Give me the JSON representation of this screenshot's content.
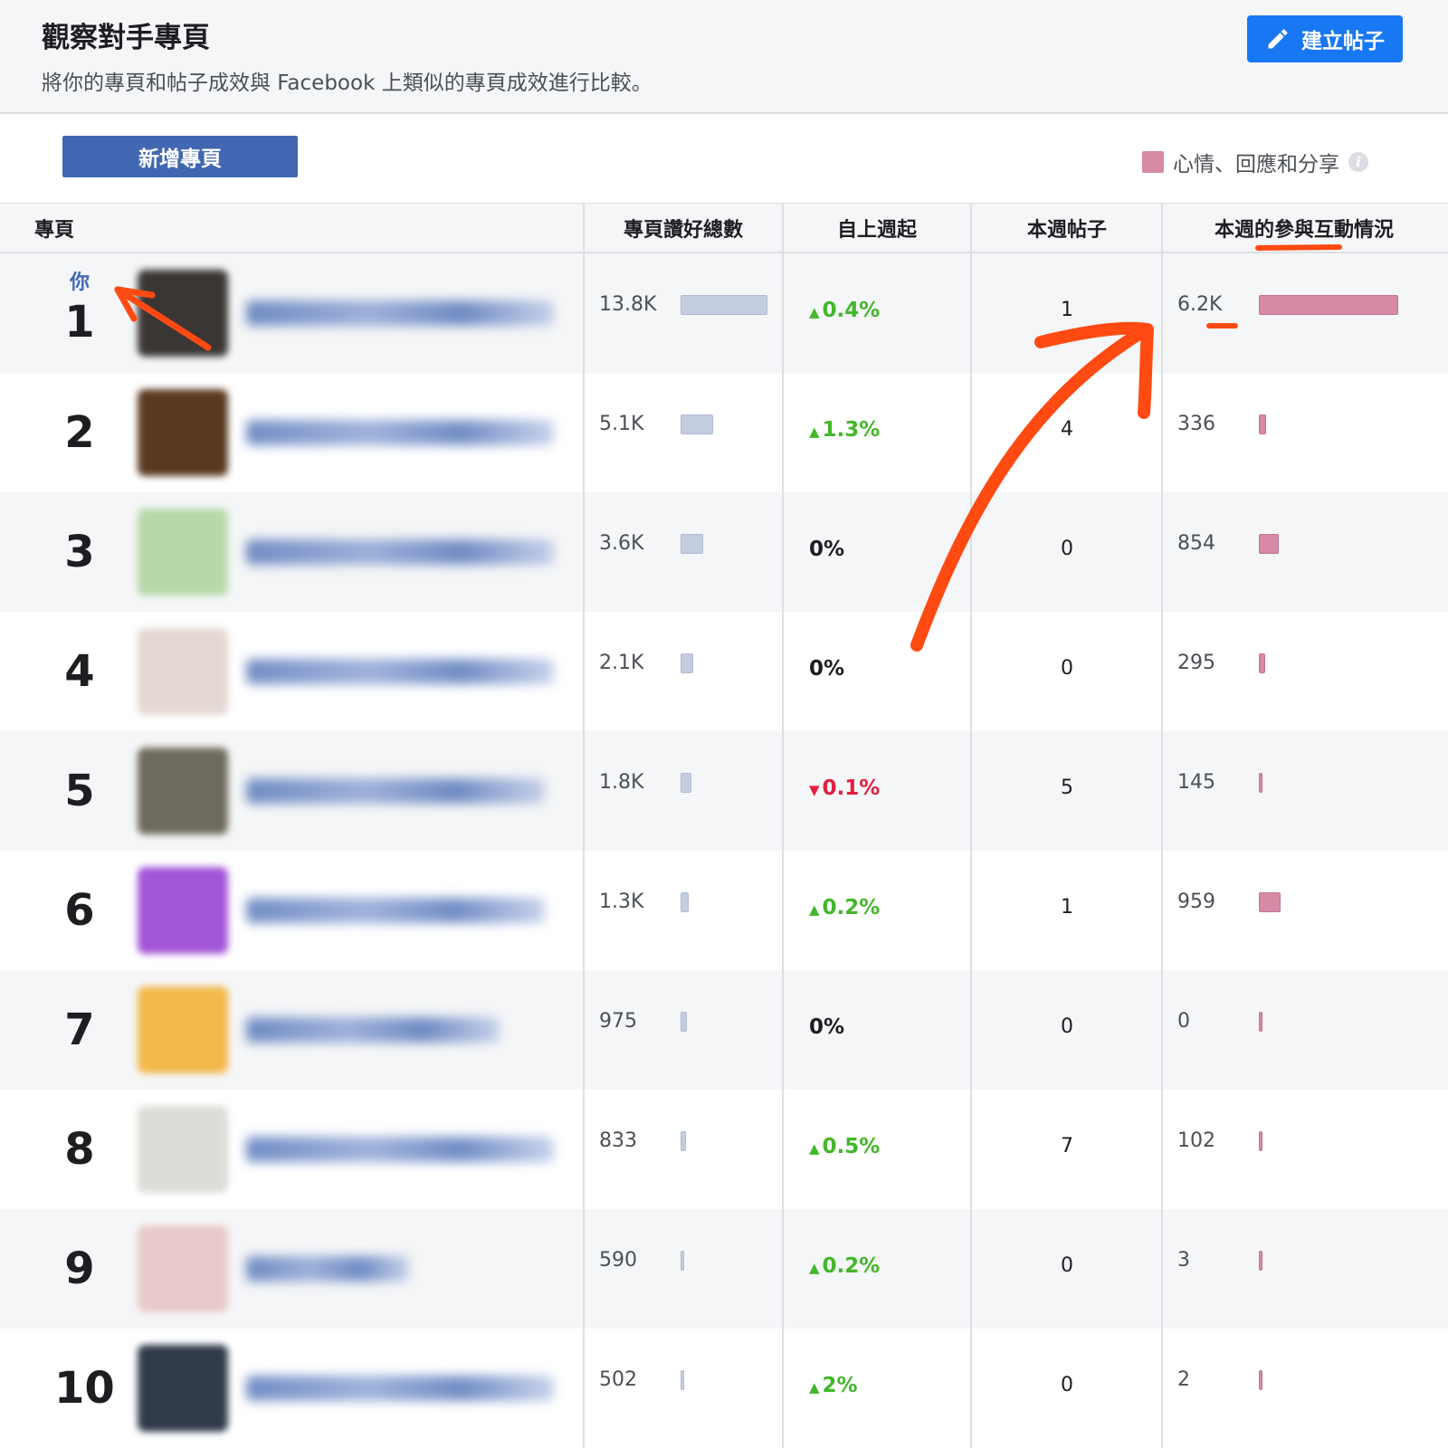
{
  "header": {
    "title": "觀察對手專頁",
    "subtitle": "將你的專頁和帖子成效與 Facebook 上類似的專頁成效進行比較。",
    "create_post_label": "建立帖子"
  },
  "toolbar": {
    "add_page_label": "新增專頁",
    "legend_label": "心情、回應和分享",
    "legend_color": "#d68aa5",
    "info_icon": "i"
  },
  "columns": [
    "專頁",
    "專頁讚好總數",
    "自上週起",
    "本週帖子",
    "本週的參與互動情況"
  ],
  "you_label": "你",
  "colors": {
    "accent": "#1877f2",
    "button": "#4267b2",
    "up": "#42b72a",
    "down": "#e41e3f",
    "annotation": "#ff4a12",
    "likes_bar": "#c4cde0",
    "engagement_bar": "#d68aa5"
  },
  "rows": [
    {
      "rank": "1",
      "likes": "13.8K",
      "likes_fraction": 1.0,
      "change": "0.4%",
      "direction": "up",
      "posts": "1",
      "engagement": "6.2K",
      "engagement_fraction": 1.0,
      "thumb_color": "#3a3634"
    },
    {
      "rank": "2",
      "likes": "5.1K",
      "likes_fraction": 0.37,
      "change": "1.3%",
      "direction": "up",
      "posts": "4",
      "engagement": "336",
      "engagement_fraction": 0.054,
      "thumb_color": "#5b3a20"
    },
    {
      "rank": "3",
      "likes": "3.6K",
      "likes_fraction": 0.26,
      "change": "0%",
      "direction": "flat",
      "posts": "0",
      "engagement": "854",
      "engagement_fraction": 0.14,
      "thumb_color": "#b6d8a8"
    },
    {
      "rank": "4",
      "likes": "2.1K",
      "likes_fraction": 0.15,
      "change": "0%",
      "direction": "flat",
      "posts": "0",
      "engagement": "295",
      "engagement_fraction": 0.048,
      "thumb_color": "#e3d8d3"
    },
    {
      "rank": "5",
      "likes": "1.8K",
      "likes_fraction": 0.13,
      "change": "0.1%",
      "direction": "down",
      "posts": "5",
      "engagement": "145",
      "engagement_fraction": 0.023,
      "thumb_color": "#6e6a5e"
    },
    {
      "rank": "6",
      "likes": "1.3K",
      "likes_fraction": 0.094,
      "change": "0.2%",
      "direction": "up",
      "posts": "1",
      "engagement": "959",
      "engagement_fraction": 0.155,
      "thumb_color": "#a355d8"
    },
    {
      "rank": "7",
      "likes": "975",
      "likes_fraction": 0.071,
      "change": "0%",
      "direction": "flat",
      "posts": "0",
      "engagement": "0",
      "engagement_fraction": 0.0,
      "thumb_color": "#f2b84a"
    },
    {
      "rank": "8",
      "likes": "833",
      "likes_fraction": 0.06,
      "change": "0.5%",
      "direction": "up",
      "posts": "7",
      "engagement": "102",
      "engagement_fraction": 0.016,
      "thumb_color": "#dcddd6"
    },
    {
      "rank": "9",
      "likes": "590",
      "likes_fraction": 0.043,
      "change": "0.2%",
      "direction": "up",
      "posts": "0",
      "engagement": "3",
      "engagement_fraction": 0.0005,
      "thumb_color": "#e8c9c9"
    },
    {
      "rank": "10",
      "likes": "502",
      "likes_fraction": 0.036,
      "change": "2%",
      "direction": "up",
      "posts": "0",
      "engagement": "2",
      "engagement_fraction": 0.0003,
      "thumb_color": "#2f3a4a"
    }
  ]
}
